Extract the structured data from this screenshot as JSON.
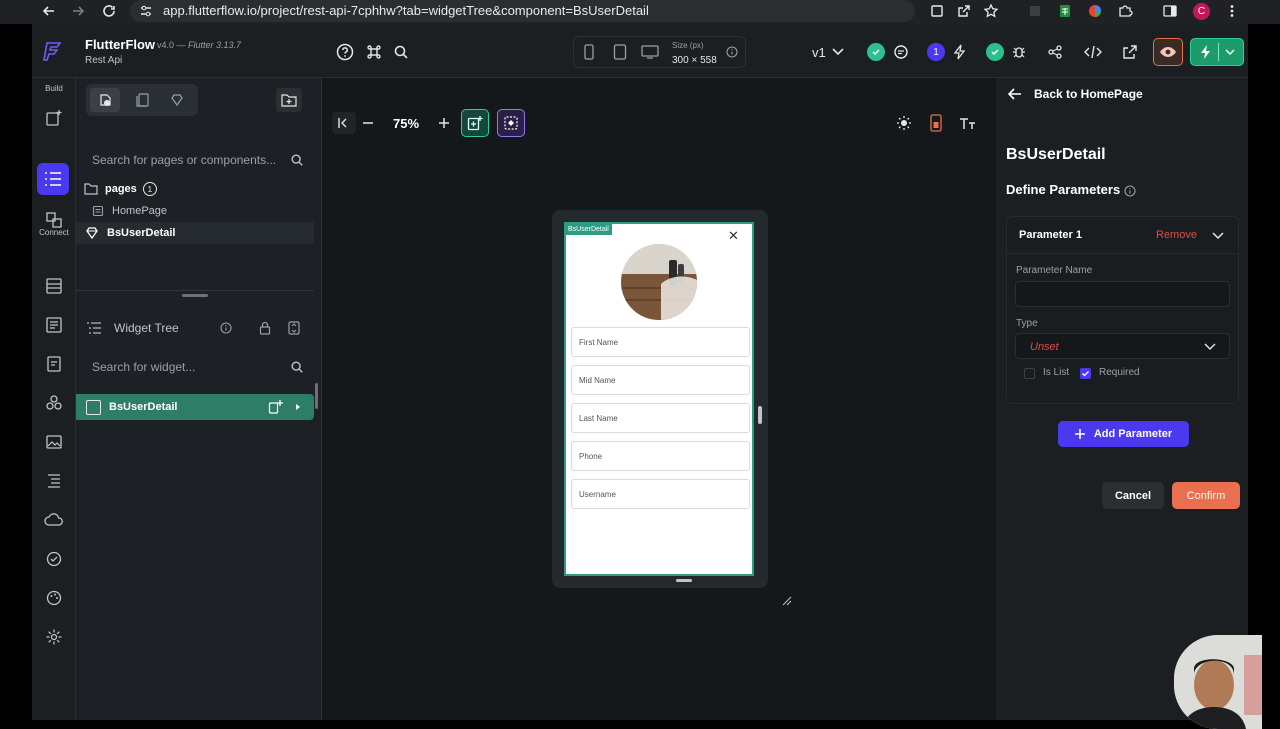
{
  "browser": {
    "url": "app.flutterflow.io/project/rest-api-7cphhw?tab=widgetTree&component=BsUserDetail",
    "profile_initial": "C"
  },
  "app": {
    "name": "FlutterFlow",
    "version": "v4.0 —",
    "flutter_version": "Flutter 3.13.7",
    "project": "Rest Api"
  },
  "topbar": {
    "size_label": "Size (px)",
    "size_value": "300 × 558",
    "version_selector": "v1",
    "badge_count": "1"
  },
  "leftrail": {
    "build_label": "Build",
    "connect_label": "Connect"
  },
  "leftpanel": {
    "search_placeholder": "Search for pages or components...",
    "folder_label": "pages",
    "folder_count": "1",
    "items": [
      {
        "label": "HomePage"
      },
      {
        "label": "BsUserDetail"
      }
    ],
    "widget_tree_title": "Widget Tree",
    "widget_search_placeholder": "Search for widget...",
    "selected_widget": "BsUserDetail"
  },
  "canvas": {
    "zoom": "75%",
    "component_tag": "BsUserDetail",
    "close_glyph": "✕",
    "fields": [
      {
        "label": "First Name"
      },
      {
        "label": "Mid Name"
      },
      {
        "label": "Last Name"
      },
      {
        "label": "Phone"
      },
      {
        "label": "Username"
      }
    ]
  },
  "rightpanel": {
    "back_label": "Back to HomePage",
    "title": "BsUserDetail",
    "section_title": "Define Parameters",
    "parameter_title": "Parameter 1",
    "remove_label": "Remove",
    "param_name_label": "Parameter Name",
    "param_name_value": "",
    "type_label": "Type",
    "type_value": "Unset",
    "is_list_label": "Is List",
    "required_label": "Required",
    "add_param_label": "Add Parameter",
    "cancel_label": "Cancel",
    "confirm_label": "Confirm"
  },
  "colors": {
    "accent_green": "#2e7d67",
    "accent_purple": "#4b39ef",
    "remove_red": "#e2494b",
    "confirm_orange": "#e86f4f",
    "unset_red": "#e2494b"
  }
}
